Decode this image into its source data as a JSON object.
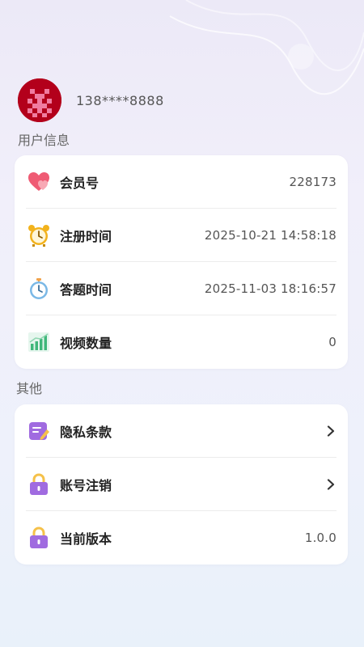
{
  "profile": {
    "phone": "138****8888"
  },
  "sections": {
    "user_info_title": "用户信息",
    "other_title": "其他"
  },
  "user_info": {
    "member_no": {
      "label": "会员号",
      "value": "228173",
      "icon": "heart-icon"
    },
    "register_time": {
      "label": "注册时间",
      "value": "2025-10-21 14:58:18",
      "icon": "alarm-clock-icon"
    },
    "answer_time": {
      "label": "答题时间",
      "value": "2025-11-03 18:16:57",
      "icon": "stopwatch-icon"
    },
    "video_count": {
      "label": "视频数量",
      "value": "0",
      "icon": "bar-chart-icon"
    }
  },
  "other": {
    "privacy": {
      "label": "隐私条款",
      "icon": "document-edit-icon"
    },
    "cancel_account": {
      "label": "账号注销",
      "icon": "lock-icon"
    },
    "version": {
      "label": "当前版本",
      "value": "1.0.0",
      "icon": "lock-icon"
    }
  },
  "colors": {
    "accent_purple": "#a06be0",
    "heart": "#ef5b74",
    "clock": "#f2b21c",
    "chart": "#3fb77a",
    "stopwatch": "#7ab8e6"
  }
}
